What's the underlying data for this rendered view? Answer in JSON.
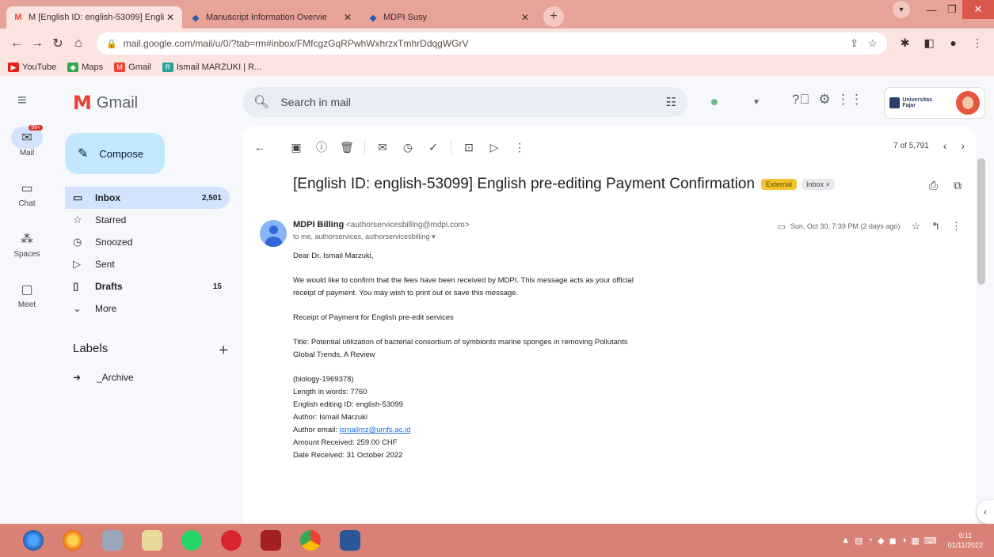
{
  "browser": {
    "tabs": [
      {
        "label": "M  [English ID: english-53099] Engli",
        "close": "✕"
      },
      {
        "label": "Manuscript Information Overvie",
        "close": "✕"
      },
      {
        "label": "MDPI Susy",
        "close": "✕"
      }
    ],
    "new_tab": "+",
    "url": "mail.google.com/mail/u/0/?tab=rm#inbox/FMfcgzGqRPwhWxhrzxTmhrDdqgWGrV",
    "bookmarks": [
      "YouTube",
      "Maps",
      "Gmail",
      "Ismail MARZUKI | R..."
    ]
  },
  "gmail": {
    "app_name": "Gmail",
    "search_placeholder": "Search in mail",
    "rail": [
      {
        "label": "Mail",
        "badge": "99+"
      },
      {
        "label": "Chat"
      },
      {
        "label": "Spaces"
      },
      {
        "label": "Meet"
      }
    ],
    "compose": "Compose",
    "nav": [
      {
        "label": "Inbox",
        "count": "2,501"
      },
      {
        "label": "Starred",
        "count": ""
      },
      {
        "label": "Snoozed",
        "count": ""
      },
      {
        "label": "Sent",
        "count": ""
      },
      {
        "label": "Drafts",
        "count": "15"
      },
      {
        "label": "More",
        "count": ""
      }
    ],
    "labels_heading": "Labels",
    "labels": [
      "_Archive"
    ],
    "pager": "7 of 5,791",
    "subject": "[English ID: english-53099] English pre-editing Payment Confirmation",
    "tag_external": "External",
    "tag_inbox": "Inbox ×",
    "sender_name": "MDPI Billing",
    "sender_email": "<authorservicesbilling@mdpi.com>",
    "to_line": "to me, authorservices, authorservicesbilling ▾",
    "date": "Sun, Oct 30, 7:39 PM (2 days ago)",
    "body": {
      "greeting": "Dear Dr. Ismail Marzuki,",
      "p1": "We would like to confirm that the fees have been received by MDPI. This message acts as your official receipt of payment. You may wish to print out or save this message.",
      "p2": "Receipt of Payment for English pre-edit services",
      "p3": "Title: Potential utilization of bacterial consortium of symbionts marine sponges in removing Pollutants Global Trends, A Review",
      "details": [
        "(biology-1969378)",
        "Length in words: 7760",
        "English editing ID: english-53099",
        "Author: Ismail Marzuki"
      ],
      "author_email_label": "Author email: ",
      "author_email": "ismailmz@umfs.ac.id",
      "amount": "Amount Received: 259.00 CHF",
      "date_received": "Date Received: 31 October 2022"
    }
  },
  "taskbar": {
    "time": "9:11",
    "date": "01/11/2022"
  }
}
